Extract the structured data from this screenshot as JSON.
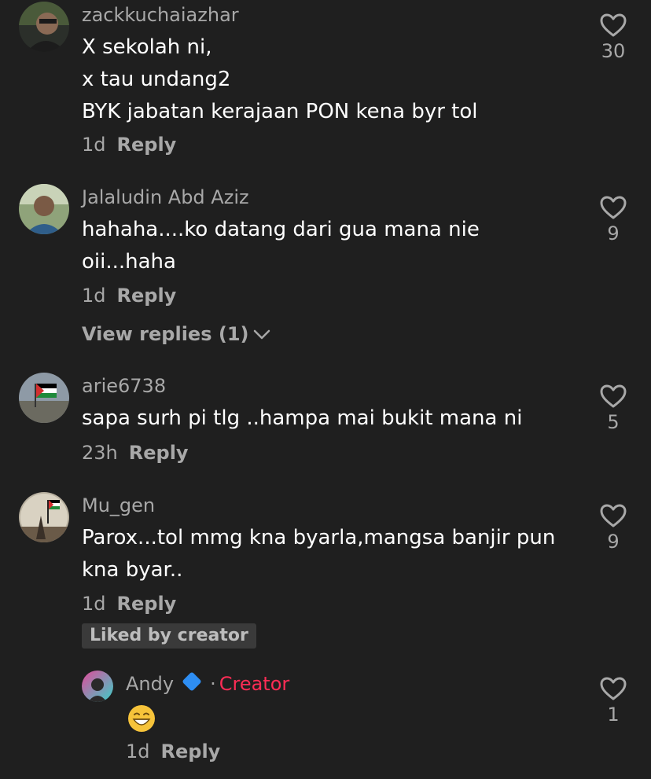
{
  "comments": [
    {
      "username": "zackkuchaiazhar",
      "lines": [
        "X sekolah ni,",
        "x tau undang2",
        "BYK jabatan kerajaan PON kena byr tol"
      ],
      "time": "1d",
      "reply_label": "Reply",
      "likes": "30"
    },
    {
      "username": "Jalaludin Abd Aziz",
      "lines": [
        "hahaha....ko datang dari gua mana nie",
        "oii...haha"
      ],
      "time": "1d",
      "reply_label": "Reply",
      "likes": "9",
      "view_replies": "View replies (1)"
    },
    {
      "username": "arie6738",
      "lines": [
        "sapa surh pi tlg ..hampa mai bukit mana ni"
      ],
      "time": "23h",
      "reply_label": "Reply",
      "likes": "5"
    },
    {
      "username": "Mu_gen",
      "lines": [
        "Parox...tol mmg kna byarla,mangsa banjir pun",
        "kna byar.."
      ],
      "time": "1d",
      "reply_label": "Reply",
      "likes": "9",
      "badge": "Liked by creator"
    }
  ],
  "reply": {
    "username": "Andy",
    "separator": "·",
    "creator_label": "Creator",
    "time": "1d",
    "reply_label": "Reply",
    "likes": "1",
    "emoji": "grinning-face-emoji"
  },
  "colors": {
    "background": "#1f1f1f",
    "username": "#a8a8a8",
    "text": "#ffffff",
    "creator": "#fe2c55",
    "verified": "#2e8ef3"
  }
}
